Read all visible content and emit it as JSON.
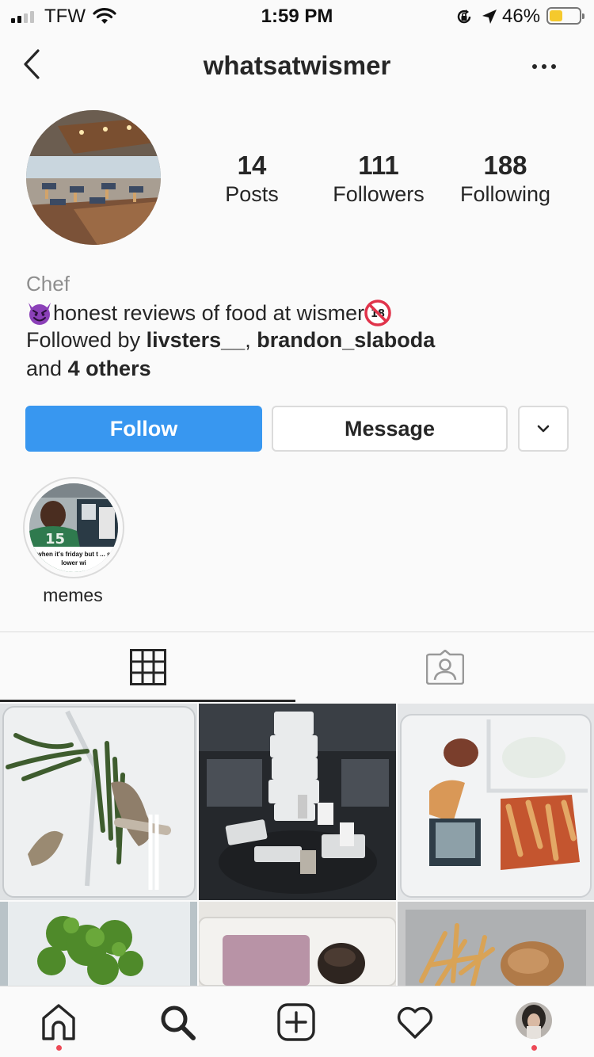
{
  "status_bar": {
    "carrier": "TFW",
    "time": "1:59 PM",
    "battery_percent": "46%",
    "battery_level": 0.46,
    "icons": [
      "signal-icon",
      "wifi-icon",
      "rotation-lock-icon",
      "location-arrow-icon",
      "battery-icon"
    ]
  },
  "header": {
    "username": "whatsatwismer",
    "icons": [
      "back-chevron-icon",
      "more-options-icon"
    ]
  },
  "profile": {
    "stats": [
      {
        "value": "14",
        "label": "Posts"
      },
      {
        "value": "111",
        "label": "Followers"
      },
      {
        "value": "188",
        "label": "Following"
      }
    ],
    "category": "Chef",
    "bio": "honest reviews of food at wismer",
    "followed_by_prefix": "Followed by ",
    "followed_by_user1": "livsters__",
    "followed_by_separator": ", ",
    "followed_by_user2": "brandon_slaboda",
    "followed_by_and": "and ",
    "followed_by_others": "4 others"
  },
  "actions": {
    "follow_label": "Follow",
    "message_label": "Message",
    "accent_color": "#3897f0"
  },
  "highlights": [
    {
      "label": "memes",
      "caption": "when it's friday but t ... s lower wi"
    }
  ],
  "tabs": {
    "icons": [
      "grid-icon",
      "tagged-icon"
    ],
    "active": "grid"
  },
  "posts": [
    {
      "depicts": "styrofoam tray with green beans and chicken bones"
    },
    {
      "depicts": "tower of stacked styrofoam containers"
    },
    {
      "depicts": "styrofoam tray with penne pasta and spinach"
    },
    {
      "depicts": "container of broccoli"
    },
    {
      "depicts": "pink pudding and muffin"
    },
    {
      "depicts": "tray of french fries and chicken"
    }
  ],
  "bottom_nav": {
    "icons": [
      "home-icon",
      "search-icon",
      "new-post-icon",
      "activity-heart-icon",
      "profile-avatar-icon"
    ],
    "notification_color": "#ed4956"
  }
}
